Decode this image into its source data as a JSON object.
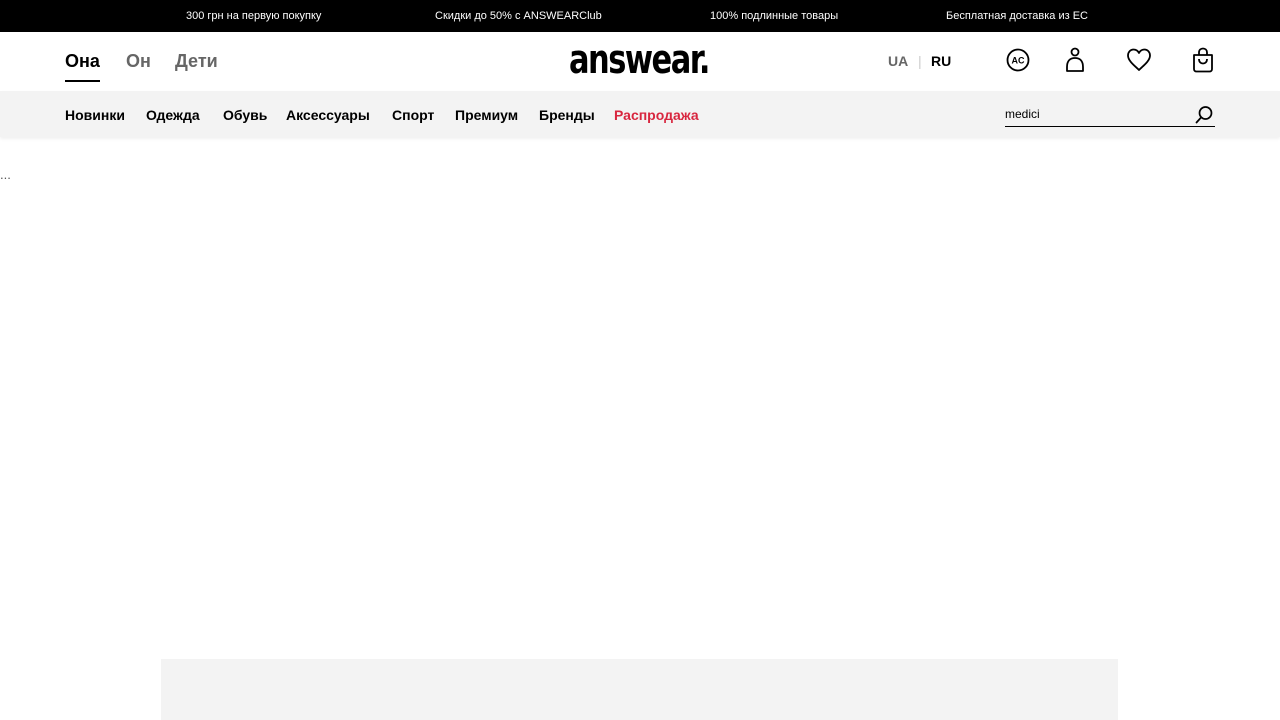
{
  "promo_bar": {
    "items": [
      "300 грн на первую покупку",
      "Скидки до 50% с ANSWEARClub",
      "100% подлинные товары",
      "Бесплатная доставка из ЕС"
    ]
  },
  "header": {
    "gender_tabs": [
      {
        "label": "Она",
        "active": true
      },
      {
        "label": "Он",
        "active": false
      },
      {
        "label": "Дети",
        "active": false
      }
    ],
    "logo_text": "answear.",
    "languages": [
      {
        "label": "UA",
        "active": false
      },
      {
        "label": "RU",
        "active": true
      }
    ],
    "icons": [
      "answear-club-icon",
      "user-icon",
      "heart-icon",
      "shopping-bag-icon"
    ]
  },
  "nav": {
    "items": [
      "Новинки",
      "Одежда",
      "Обувь",
      "Аксессуары",
      "Спорт",
      "Премиум",
      "Бренды",
      "Распродажа"
    ],
    "sale_color": "#d8263f"
  },
  "search": {
    "value": "medici"
  },
  "content": {
    "loading_text": "..."
  }
}
